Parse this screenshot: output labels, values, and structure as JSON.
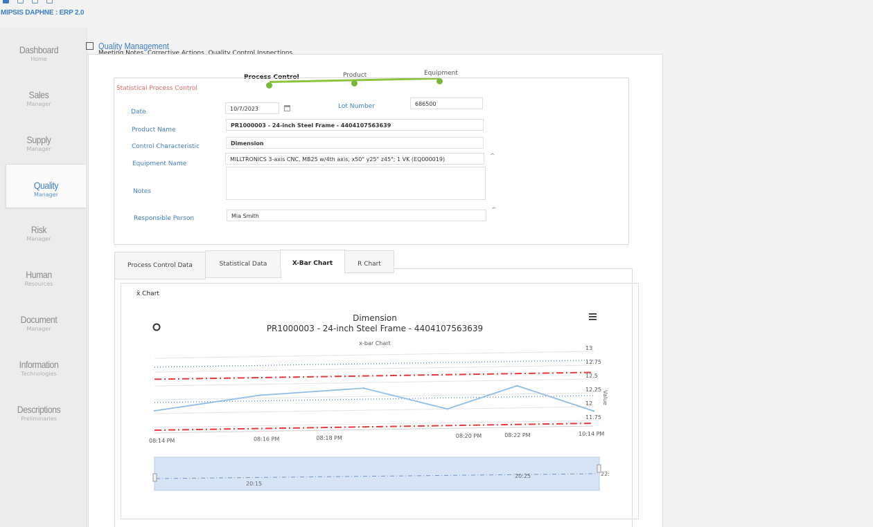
{
  "app": {
    "brand": "MIPSIS DAPHNE : ERP 2.0"
  },
  "sidebar": {
    "items": [
      {
        "title": "Dashboard",
        "sub": "Home"
      },
      {
        "title": "Sales",
        "sub": "Manager"
      },
      {
        "title": "Supply",
        "sub": "Manager"
      },
      {
        "title": "Quality",
        "sub": "Manager",
        "active": true
      },
      {
        "title": "Risk",
        "sub": "Manager"
      },
      {
        "title": "Human",
        "sub": "Resources"
      },
      {
        "title": "Document",
        "sub": "Manager"
      },
      {
        "title": "Information",
        "sub": "Technologies"
      },
      {
        "title": "Descriptions",
        "sub": "Preliminaries"
      }
    ]
  },
  "page": {
    "title": "Quality Management",
    "subtitle": "Meeting Notes, Corrective Actions, Quality Control Inspections"
  },
  "wizard": {
    "steps": [
      "Process Control",
      "Product",
      "Equipment"
    ],
    "active": "Process Control"
  },
  "form": {
    "legend": "Statistical Process Control",
    "date_label": "Date",
    "date_value": "10/7/2023",
    "lot_label": "Lot Number",
    "lot_value": "686500",
    "product_label": "Product Name",
    "product_value": "PR1000003 - 24-inch Steel Frame - 4404107563639",
    "control_label": "Control Characteristic",
    "control_value": "Dimension",
    "equipment_label": "Equipment Name",
    "equipment_value": "MILLTRONICS 3-axis CNC, MB25 w/4th axis, x50\" y25\" z45\"; 1 VK (EQ000019)",
    "notes_label": "Notes",
    "notes_value": "",
    "person_label": "Responsible Person",
    "person_value": "Mia Smith",
    "caret": "^"
  },
  "tabs": [
    "Process Control Data",
    "Statistical Data",
    "X-Bar Chart",
    "R Chart"
  ],
  "active_tab": "X-Bar Chart",
  "chart_panel_legend": "x̄ Chart",
  "chart_data": {
    "type": "line",
    "title": "Dimension",
    "subtitle": "PR1000003 - 24-inch Steel Frame - 4404107563639",
    "caption": "x-bar Chart",
    "ylabel": "Value",
    "ylim": [
      11.75,
      13
    ],
    "yticks": [
      "13",
      "12.75",
      "12.5",
      "12.25",
      "12",
      "11.75"
    ],
    "xticks": [
      "08:14 PM",
      "08:16 PM",
      "08:18 PM",
      "08:20 PM",
      "08:22 PM",
      "10:14 PM"
    ],
    "series": [
      {
        "x": [
          0,
          1.5,
          3,
          4.2,
          5.2,
          6.3
        ],
        "values": [
          12.05,
          12.3,
          12.4,
          12.0,
          12.4,
          11.92
        ]
      }
    ],
    "center_line": 12.2,
    "ucl": 12.62,
    "lcl": 11.7,
    "top_dotted": 12.84,
    "navigator_labels": [
      "20:15",
      "20:25",
      "22:"
    ],
    "colors": {
      "series": "#8fbde8",
      "limits": "#e8383b",
      "center": "#4a7cc9"
    }
  },
  "colors": {
    "accent": "#3d7fc7",
    "wizard": "#8cc440"
  }
}
